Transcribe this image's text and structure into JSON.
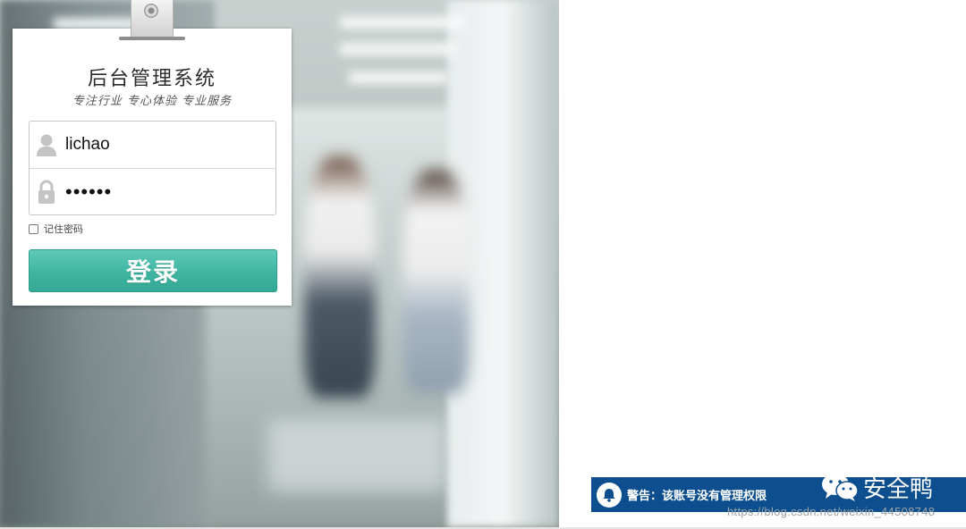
{
  "login": {
    "title": "后台管理系统",
    "subtitle": "专注行业  专心体验  专业服务",
    "username_value": "lichao",
    "password_value": "••••••",
    "remember_label": "记住密码",
    "login_label": "登录"
  },
  "alert": {
    "message": "警告：该账号没有管理权限",
    "icon": "bell-icon"
  },
  "brand": {
    "name": "安全鸭",
    "icon": "wechat-icon"
  },
  "watermark": {
    "text": "https://blog.csdn.net/weixin_44508748"
  },
  "colors": {
    "button": "#3fb5a1",
    "alert_bg": "#0d4f8e"
  }
}
